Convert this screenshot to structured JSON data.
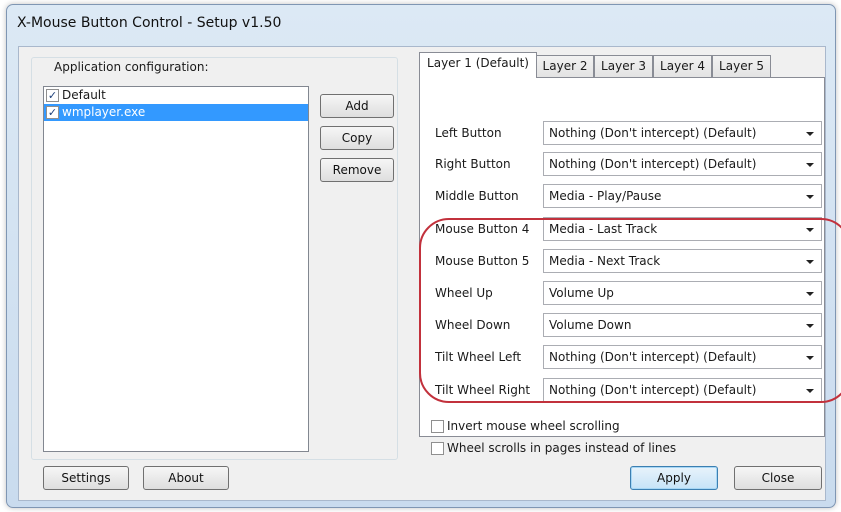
{
  "window": {
    "title": "X-Mouse Button Control - Setup v1.50"
  },
  "app_config": {
    "group_title": "Application configuration:",
    "items": [
      {
        "label": "Default",
        "checked": true,
        "selected": false
      },
      {
        "label": "wmplayer.exe",
        "checked": true,
        "selected": true
      }
    ]
  },
  "side_buttons": {
    "add": "Add",
    "copy": "Copy",
    "remove": "Remove"
  },
  "tabs": [
    {
      "label": "Layer 1 (Default)",
      "active": true
    },
    {
      "label": "Layer 2",
      "active": false
    },
    {
      "label": "Layer 3",
      "active": false
    },
    {
      "label": "Layer 4",
      "active": false
    },
    {
      "label": "Layer 5",
      "active": false
    }
  ],
  "mappings": [
    {
      "label": "Left Button",
      "value": "Nothing (Don't intercept) (Default)"
    },
    {
      "label": "Right Button",
      "value": "Nothing (Don't intercept) (Default)"
    },
    {
      "label": "Middle Button",
      "value": "Media - Play/Pause"
    },
    {
      "label": "Mouse Button 4",
      "value": "Media - Last Track"
    },
    {
      "label": "Mouse Button 5",
      "value": "Media - Next Track"
    },
    {
      "label": "Wheel Up",
      "value": "Volume Up"
    },
    {
      "label": "Wheel Down",
      "value": "Volume Down"
    },
    {
      "label": "Tilt Wheel Left",
      "value": "Nothing (Don't intercept) (Default)"
    },
    {
      "label": "Tilt Wheel Right",
      "value": "Nothing (Don't intercept) (Default)"
    }
  ],
  "options": {
    "invert_scroll": "Invert mouse wheel scrolling",
    "wheel_pages": "Wheel scrolls in pages instead of lines"
  },
  "bottom_buttons": {
    "settings": "Settings",
    "about": "About",
    "apply": "Apply",
    "close": "Close"
  },
  "colors": {
    "highlight": "#c2313c",
    "selection": "#3399ff"
  }
}
